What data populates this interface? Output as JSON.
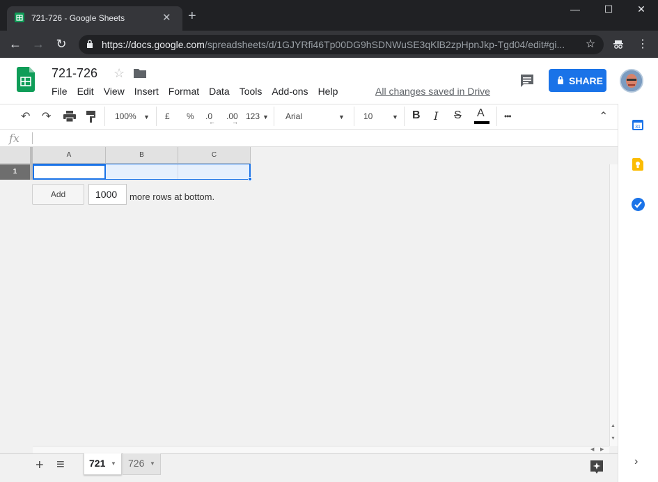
{
  "browser": {
    "tab_title": "721-726 - Google Sheets",
    "tab_close": "✕",
    "new_tab": "+",
    "url_host": "https://docs.google.com",
    "url_path": "/spreadsheets/d/1GJYRfi46Tp00DG9hSDNWuSE3qKlB2zpHpnJkp-Tgd04/edit#gi...",
    "window_controls": [
      "—",
      "☐",
      "✕"
    ]
  },
  "doc": {
    "title": "721-726",
    "menu": [
      "File",
      "Edit",
      "View",
      "Insert",
      "Format",
      "Data",
      "Tools",
      "Add-ons",
      "Help"
    ],
    "saved_status": "All changes saved in Drive",
    "share_label": "SHARE"
  },
  "toolbar": {
    "zoom": "100%",
    "currency": "£",
    "percent": "%",
    "dec_decrease": ".0",
    "dec_increase": ".00",
    "number_format": "123",
    "font": "Arial",
    "font_size": "10",
    "bold": "B",
    "italic": "I",
    "strike": "S",
    "text_color": "A",
    "more": "•••"
  },
  "formula_bar": {
    "fx": "fx",
    "value": ""
  },
  "grid": {
    "columns": [
      "A",
      "B",
      "C"
    ],
    "rows": [
      "1"
    ],
    "add_button": "Add",
    "add_rows_value": "1000",
    "add_rows_suffix": "more rows at bottom."
  },
  "sheets": {
    "tabs": [
      "721",
      "726"
    ],
    "active": "721",
    "add_icon": "+",
    "list_icon": "≡"
  },
  "colors": {
    "accent": "#1a73e8",
    "sheets_green": "#0f9d58",
    "selection": "#e6f0fd"
  }
}
